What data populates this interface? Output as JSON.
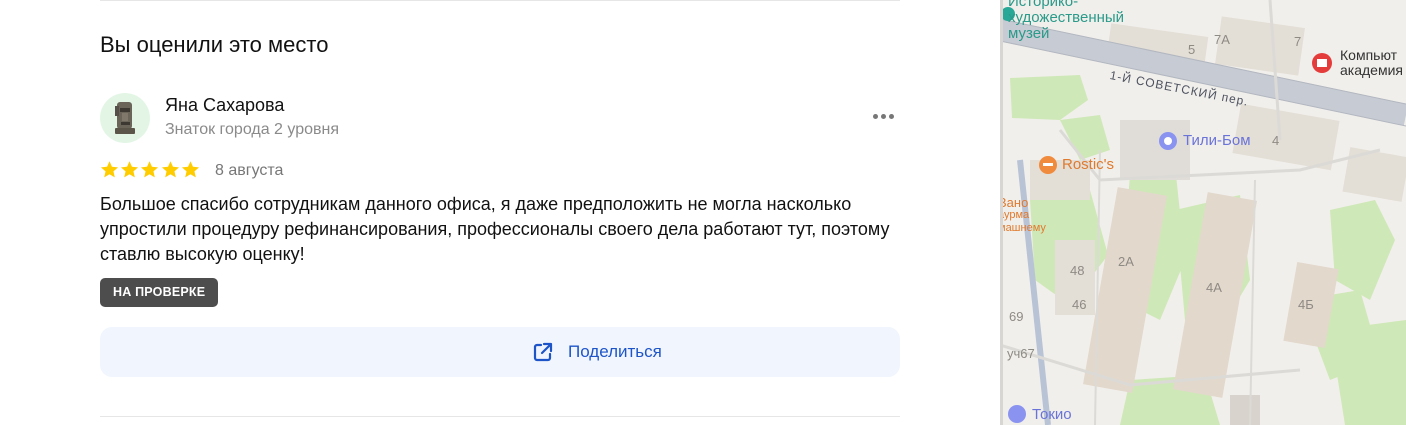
{
  "section": {
    "title": "Вы оценили это место"
  },
  "review": {
    "author_name": "Яна Сахарова",
    "author_level": "Знаток города 2 уровня",
    "rating": 5,
    "date": "8 августа",
    "text": "Большое спасибо сотрудникам данного офиса, я даже предположить не могла насколько упростили процедуру рефинансирования, профессионалы своего дела работают тут, поэтому ставлю высокую оценку!",
    "status_badge": "НА ПРОВЕРКЕ",
    "star_color": "#fc0",
    "badge_color": "#4d4d4d"
  },
  "share": {
    "label": "Поделиться",
    "color": "#1d55c9"
  },
  "icons": {
    "more": "more-dots-icon",
    "share": "share-external-icon",
    "star": "star-icon"
  },
  "map": {
    "labels": {
      "museum_1": "Историко-",
      "museum_2": "художественный",
      "museum_3": "музей",
      "street": "1-Й СОВЕТСКИЙ пер.",
      "computer_1": "Компьют",
      "computer_2": "академия",
      "tili_bom": "Тили-Бом",
      "rostics": "Rostic's",
      "vano_1": "Вано",
      "vano_2": "аурма",
      "vano_3": "машнему",
      "tokio": "Токио",
      "house_5": "5",
      "house_7a": "7А",
      "house_7": "7",
      "house_4": "4",
      "house_2a": "2А",
      "house_4a": "4А",
      "house_4b": "4Б",
      "house_48": "48",
      "house_46": "46",
      "house_69": "69",
      "house_uch67": "уч67"
    }
  }
}
